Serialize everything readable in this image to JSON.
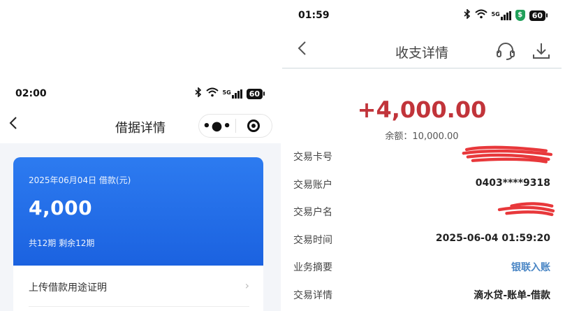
{
  "left": {
    "status": {
      "time": "02:00",
      "signal": "5G",
      "battery": "60"
    },
    "nav": {
      "title": "借据详情"
    },
    "card": {
      "date_label": "2025年06月04日 借款(元)",
      "amount": "4,000",
      "term": "共12期  剩余12期"
    },
    "upload": {
      "label": "上传借款用途证明"
    }
  },
  "right": {
    "status": {
      "time": "01:59",
      "signal": "5G",
      "battery": "60"
    },
    "nav": {
      "title": "收支详情"
    },
    "amount": "+4,000.00",
    "balance": "余额：10,000.00",
    "rows": [
      {
        "key": "交易卡号",
        "value": ""
      },
      {
        "key": "交易账户",
        "value": "0403****9318"
      },
      {
        "key": "交易户名",
        "value": ""
      },
      {
        "key": "交易时间",
        "value": "2025-06-04 01:59:20"
      },
      {
        "key": "业务摘要",
        "value": "银联入账"
      },
      {
        "key": "交易详情",
        "value": "滴水贷-账单-借款"
      }
    ]
  },
  "colors": {
    "card_blue": "#1b62e0",
    "amount_red": "#c1343a",
    "link_blue": "#4a86c5",
    "redaction": "#e8383b"
  },
  "icons": [
    "bluetooth-icon",
    "wifi-icon",
    "signal-icon",
    "battery-icon",
    "more-dots-icon",
    "target-icon",
    "back-icon",
    "headset-icon",
    "download-icon",
    "shield-icon",
    "chevron-right-icon"
  ]
}
